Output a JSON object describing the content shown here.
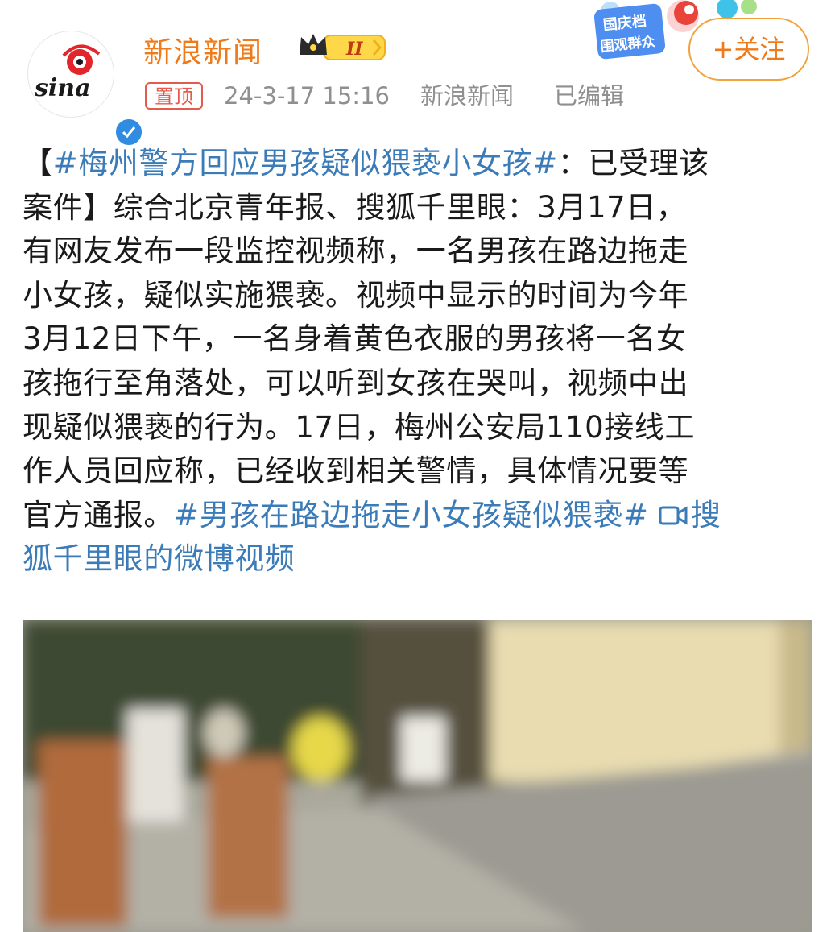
{
  "post_header": {
    "user_name": "新浪新闻",
    "avatar_logo_text": "sina",
    "vip_level": "II",
    "pin_label": "置顶",
    "timestamp": "24-3-17 15:16",
    "source": "新浪新闻",
    "edited_label": "已编辑",
    "promo_text_line1": "国庆档",
    "promo_text_line2": "围观群众",
    "follow_button_label": "+关注"
  },
  "post_body": {
    "bracket_open": "【",
    "topic_title": "#梅州警方回应男孩疑似猥亵小女孩#",
    "line1_tail": "：已受理该",
    "line2": "案件】综合北京青年报、搜狐千里眼：3月17日，",
    "line3": "有网友发布一段监控视频称，一名男孩在路边拖走",
    "line4": "小女孩，疑似实施猥亵。视频中显示的时间为今年",
    "line5": "3月12日下午，一名身着黄色衣服的男孩将一名女",
    "line6": "孩拖行至角落处，可以听到女孩在哭叫，视频中出",
    "line7": "现疑似猥亵的行为。17日，梅州公安局110接线工",
    "line8": "作人员回应称，已经收到相关警情，具体情况要等",
    "line9_head": "官方通报。",
    "topic_link_2": "#男孩在路边拖走小女孩疑似猥亵#",
    "video_link_line9": "搜",
    "video_link_line10": "狐千里眼的微博视频"
  },
  "colors": {
    "brand_orange": "#ef7a1a",
    "link_blue": "#3a7bb8",
    "pin_red": "#e35b4d",
    "meta_gray": "#8f8f8f",
    "verified_blue": "#2f8ce0"
  },
  "icons": [
    "verified-badge-icon",
    "crown-icon",
    "video-camera-icon"
  ]
}
